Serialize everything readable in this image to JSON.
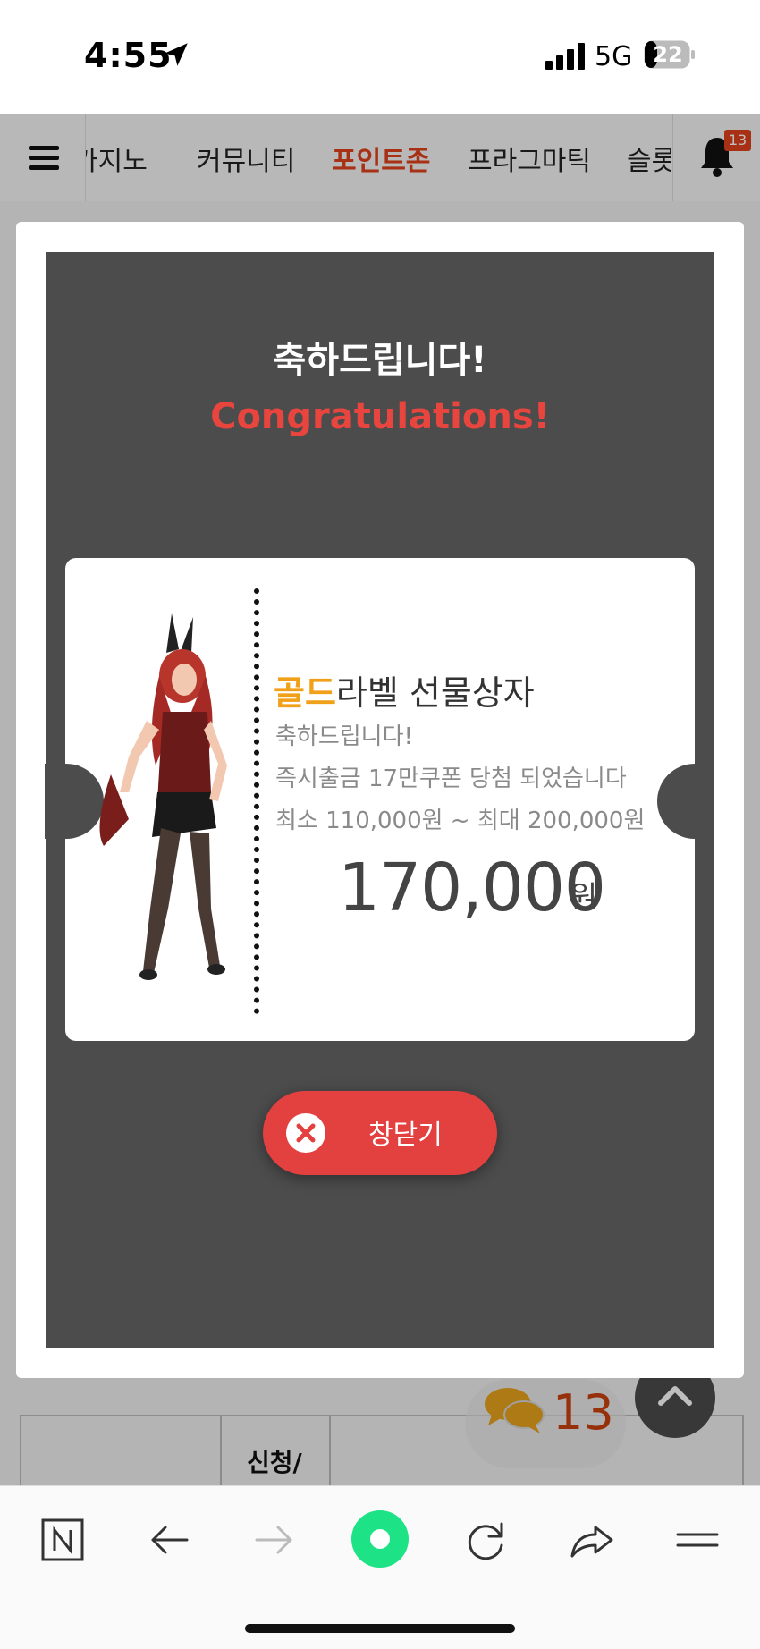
{
  "status_bar": {
    "time": "4:55",
    "network": "5G",
    "battery": "22"
  },
  "nav": {
    "tabs": [
      "카지노",
      "커뮤니티",
      "포인트존",
      "프라그마틱",
      "슬롯"
    ],
    "active_tab": "포인트존",
    "notification_count": "13"
  },
  "modal": {
    "title_ko": "축하드립니다!",
    "title_en": "Congratulations!",
    "ticket": {
      "label_highlight": "골드",
      "label_rest": "라벨 선물상자",
      "lines": [
        "축하드립니다!",
        "즉시출금 17만쿠폰 당첨 되었습니다",
        "최소 110,000원 ~ 최대 200,000원"
      ],
      "amount": "170,000",
      "unit": "원"
    },
    "close_label": "창닫기"
  },
  "background": {
    "table_text": "신청/",
    "chat_count": "13"
  },
  "colors": {
    "accent": "#e0401c",
    "modal_inner": "#4c4c4d",
    "gold": "#f1a019",
    "close_button": "#e34040",
    "congrats_en": "#e8453f"
  },
  "icons": {
    "location": "location-arrow-icon",
    "menu": "hamburger-icon",
    "bell": "bell-icon",
    "close": "close-x-icon",
    "chat": "chat-bubbles-icon",
    "scroll_top": "chevron-up-icon",
    "toolbar": [
      "naver-icon",
      "back-arrow-icon",
      "forward-arrow-icon",
      "home-circle-icon",
      "refresh-icon",
      "share-icon",
      "menu-lines-icon"
    ]
  }
}
